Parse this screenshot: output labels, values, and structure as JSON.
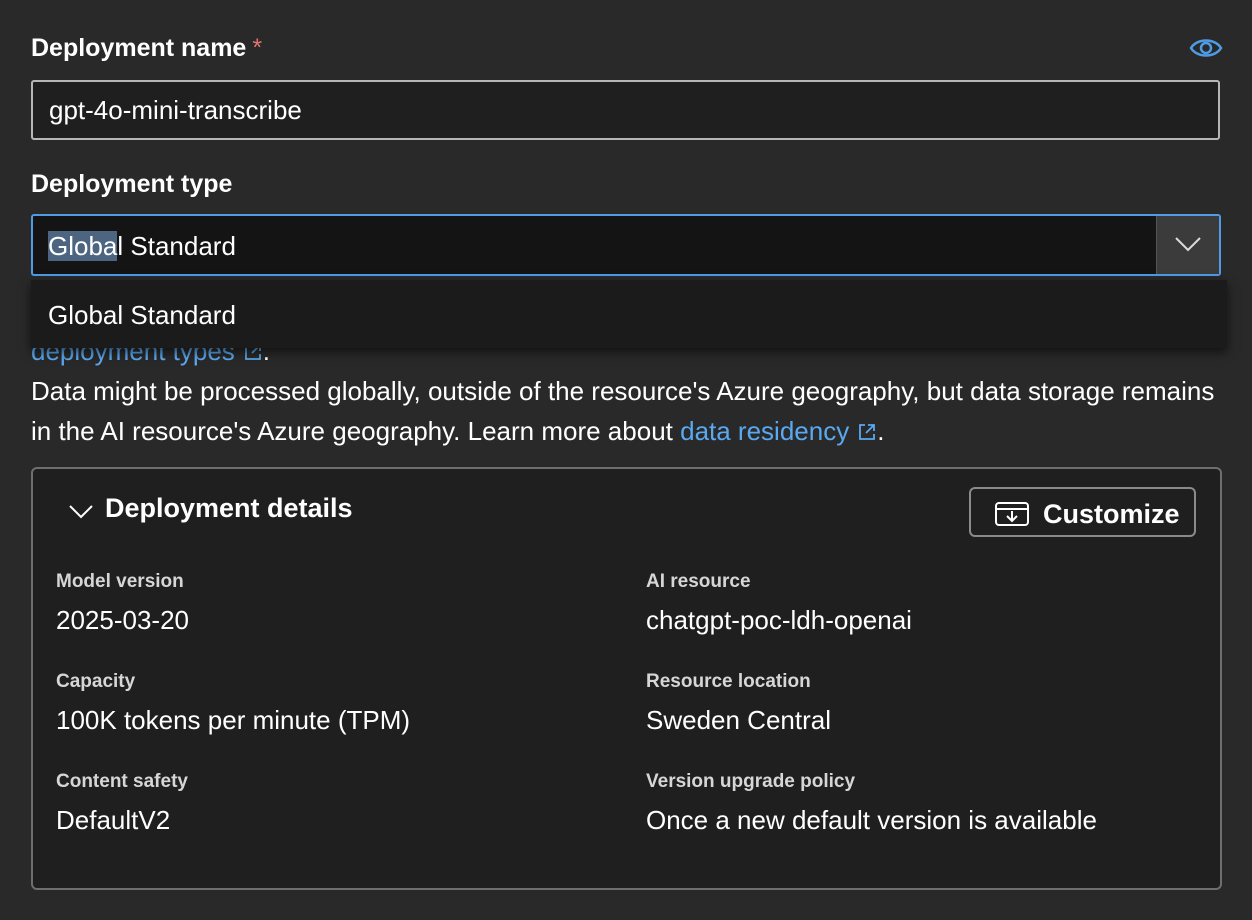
{
  "deployment_name": {
    "label": "Deployment name",
    "required_marker": "*",
    "value": "gpt-4o-mini-transcribe"
  },
  "deployment_type": {
    "label": "Deployment type",
    "selected_highlight": "Globa",
    "selected_rest": "l Standard",
    "options": [
      "Global Standard"
    ]
  },
  "info": {
    "partial_link": "deployment types",
    "partial_link_suffix": ".",
    "text": "Data might be processed globally, outside of the resource's Azure geography, but data storage remains in the AI resource's Azure geography. Learn more about",
    "link": "data residency",
    "suffix": "."
  },
  "details": {
    "title": "Deployment details",
    "customize_label": "Customize",
    "items": [
      {
        "label": "Model version",
        "value": "2025-03-20"
      },
      {
        "label": "AI resource",
        "value": "chatgpt-poc-ldh-openai"
      },
      {
        "label": "Capacity",
        "value": "100K tokens per minute (TPM)"
      },
      {
        "label": "Resource location",
        "value": "Sweden Central"
      },
      {
        "label": "Content safety",
        "value": "DefaultV2"
      },
      {
        "label": "Version upgrade policy",
        "value": "Once a new default version is available"
      }
    ]
  },
  "colors": {
    "background": "#292929",
    "accent": "#4f9be6",
    "link": "#5aa9f0",
    "required": "#e57373"
  },
  "icons": [
    "eye-icon",
    "chevron-down-icon",
    "external-link-icon",
    "customize-icon"
  ]
}
